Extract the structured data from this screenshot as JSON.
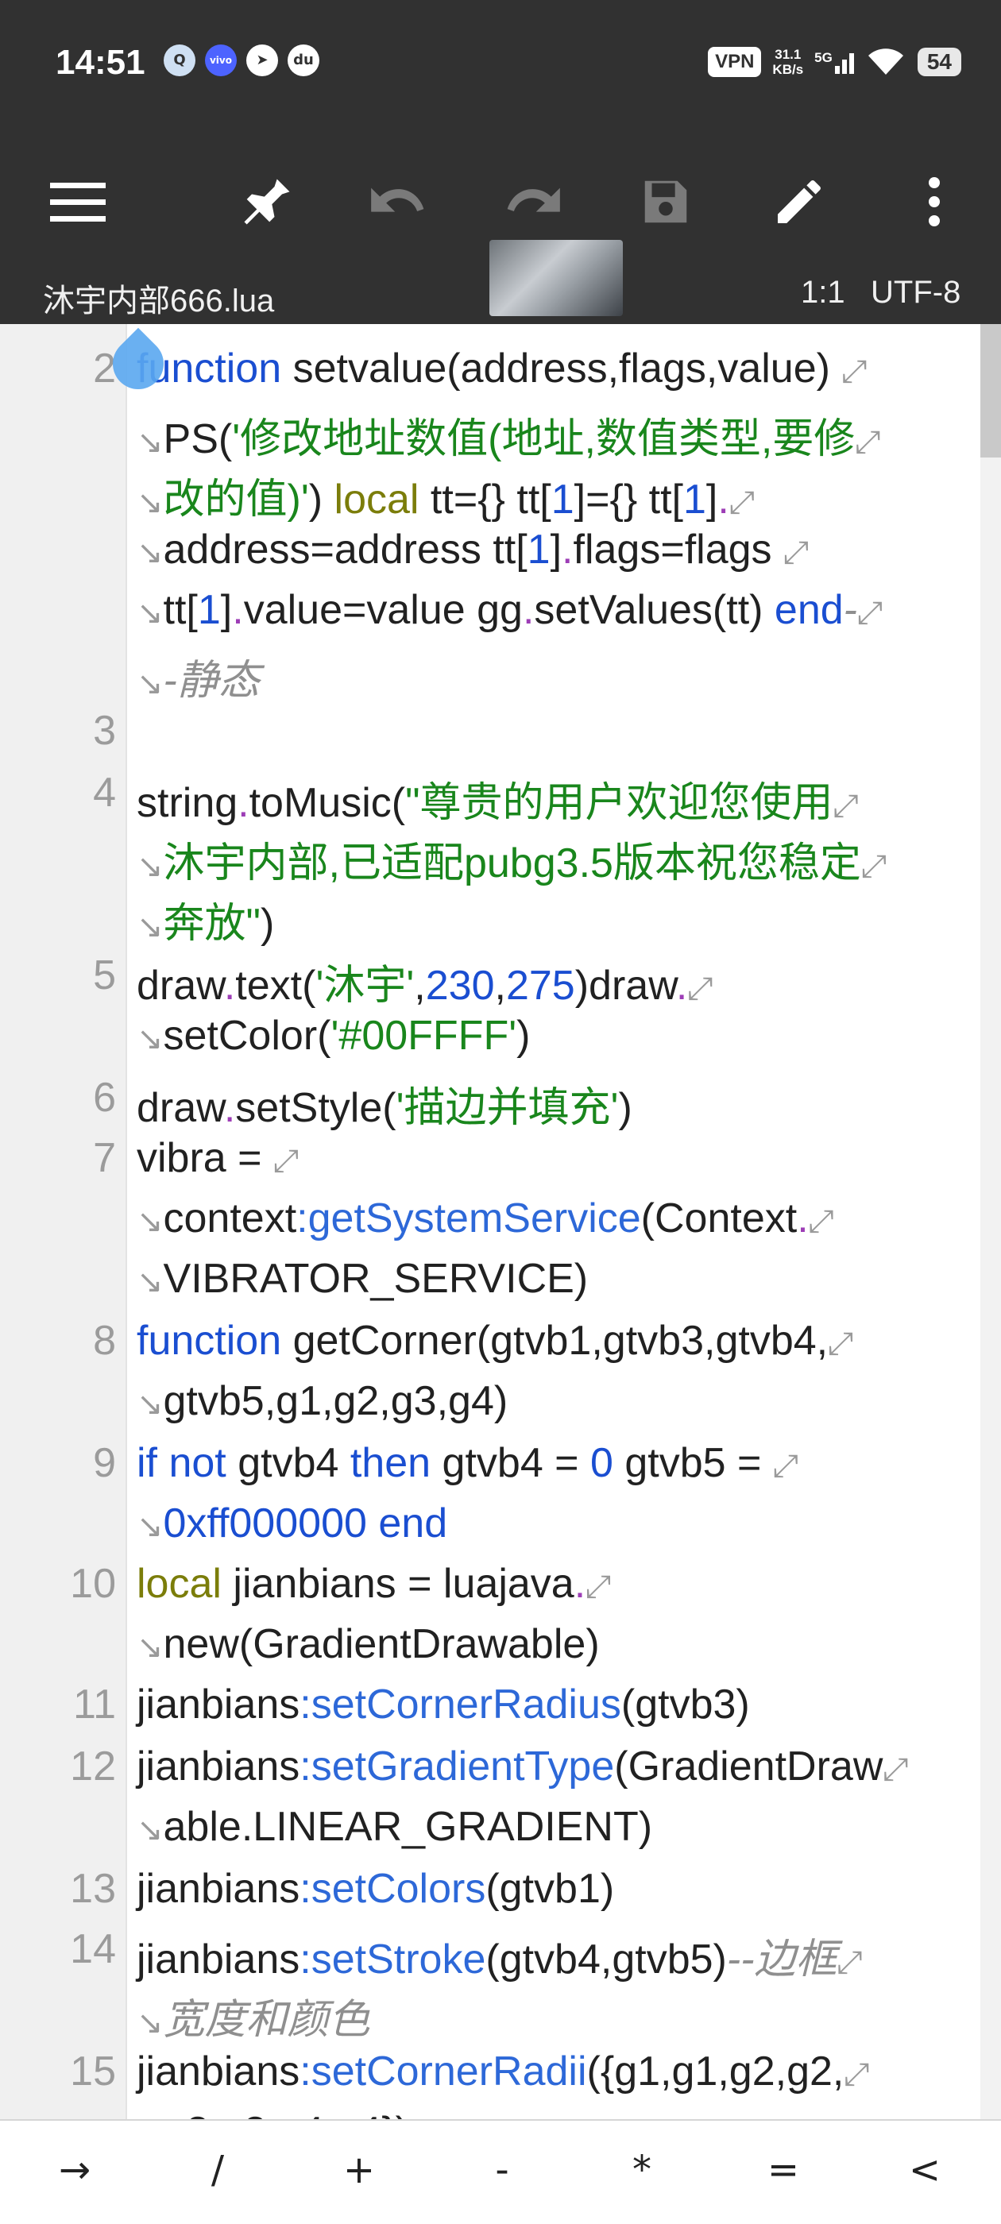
{
  "status_bar": {
    "time": "14:51",
    "vpn": "VPN",
    "speed_value": "31.1",
    "speed_unit": "KB/s",
    "network": "5G",
    "battery": "54",
    "apps": [
      "qq",
      "vivo",
      "telegram",
      "du"
    ]
  },
  "toolbar": {
    "icons": [
      "menu-icon",
      "pin-icon",
      "undo-icon",
      "redo-icon",
      "save-icon",
      "edit-icon",
      "more-icon"
    ]
  },
  "file": {
    "name": "沐宇内部666.lua",
    "position": "1:1",
    "encoding": "UTF-8"
  },
  "code": {
    "line_numbers": [
      "2",
      "3",
      "4",
      "5",
      "6",
      "7",
      "8",
      "9",
      "10",
      "11",
      "12",
      "13",
      "14",
      "15"
    ]
  },
  "keys": [
    "→",
    "/",
    "+",
    "-",
    "*",
    "=",
    "<"
  ]
}
